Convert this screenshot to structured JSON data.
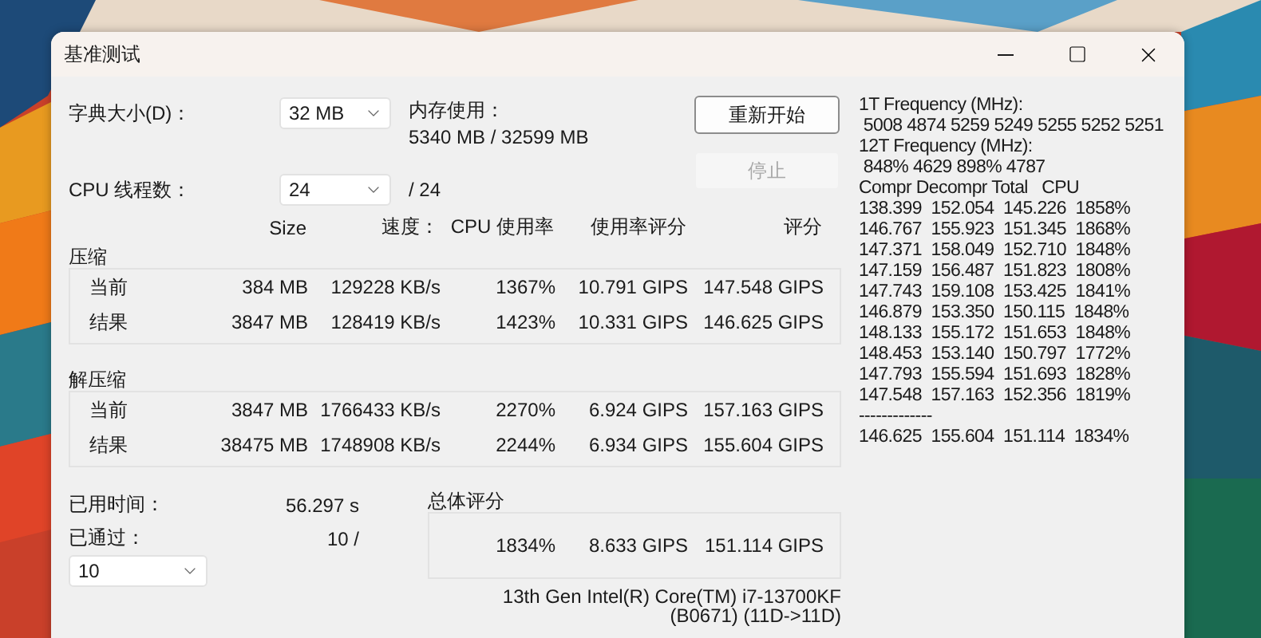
{
  "window": {
    "title": "基准测试"
  },
  "dictionary": {
    "label": "字典大小(D)：",
    "value": "32 MB"
  },
  "memory": {
    "label": "内存使用：",
    "value": "5340 MB / 32599 MB"
  },
  "threads": {
    "label": "CPU 线程数：",
    "value": "24",
    "total": "/ 24"
  },
  "buttons": [
    {
      "label": "重新开始",
      "disabled": false
    },
    {
      "label": "停止",
      "disabled": true
    }
  ],
  "columns": [
    "Size",
    "速度：",
    "CPU 使用率",
    "使用率评分",
    "评分"
  ],
  "groups": [
    {
      "title": "压缩",
      "rows": [
        {
          "label": "当前",
          "cells": [
            "384 MB",
            "129228 KB/s",
            "1367%",
            "10.791 GIPS",
            "147.548 GIPS"
          ]
        },
        {
          "label": "结果",
          "cells": [
            "3847 MB",
            "128419 KB/s",
            "1423%",
            "10.331 GIPS",
            "146.625 GIPS"
          ]
        }
      ]
    },
    {
      "title": "解压缩",
      "rows": [
        {
          "label": "当前",
          "cells": [
            "3847 MB",
            "1766433 KB/s",
            "2270%",
            "6.924 GIPS",
            "157.163 GIPS"
          ]
        },
        {
          "label": "结果",
          "cells": [
            "38475 MB",
            "1748908 KB/s",
            "2244%",
            "6.934 GIPS",
            "155.604 GIPS"
          ]
        }
      ]
    }
  ],
  "elapsed": {
    "label": "已用时间：",
    "value": "56.297 s"
  },
  "passes": {
    "label": "已通过：",
    "value": "10 /",
    "dropdown": "10"
  },
  "overall": {
    "title": "总体评分",
    "cells": [
      "1834%",
      "8.633 GIPS",
      "151.114 GIPS"
    ]
  },
  "cpu_name": [
    "13th Gen Intel(R) Core(TM) i7-13700KF",
    "(B0671) (11D->11D)"
  ],
  "log": [
    "1T Frequency (MHz):",
    " 5008 4874 5259 5249 5255 5252 5251",
    "12T Frequency (MHz):",
    " 848% 4629 898% 4787",
    "Compr Decompr Total   CPU",
    "138.399  152.054  145.226  1858%",
    "146.767  155.923  151.345  1868%",
    "147.371  158.049  152.710  1848%",
    "147.159  156.487  151.823  1808%",
    "147.743  159.108  153.425  1841%",
    "146.879  153.350  150.115  1848%",
    "148.133  155.172  151.653  1848%",
    "148.453  153.140  150.797  1772%",
    "147.793  155.594  151.693  1828%",
    "147.548  157.163  152.356  1819%",
    "-------------",
    "146.625  155.604  151.114  1834%"
  ]
}
